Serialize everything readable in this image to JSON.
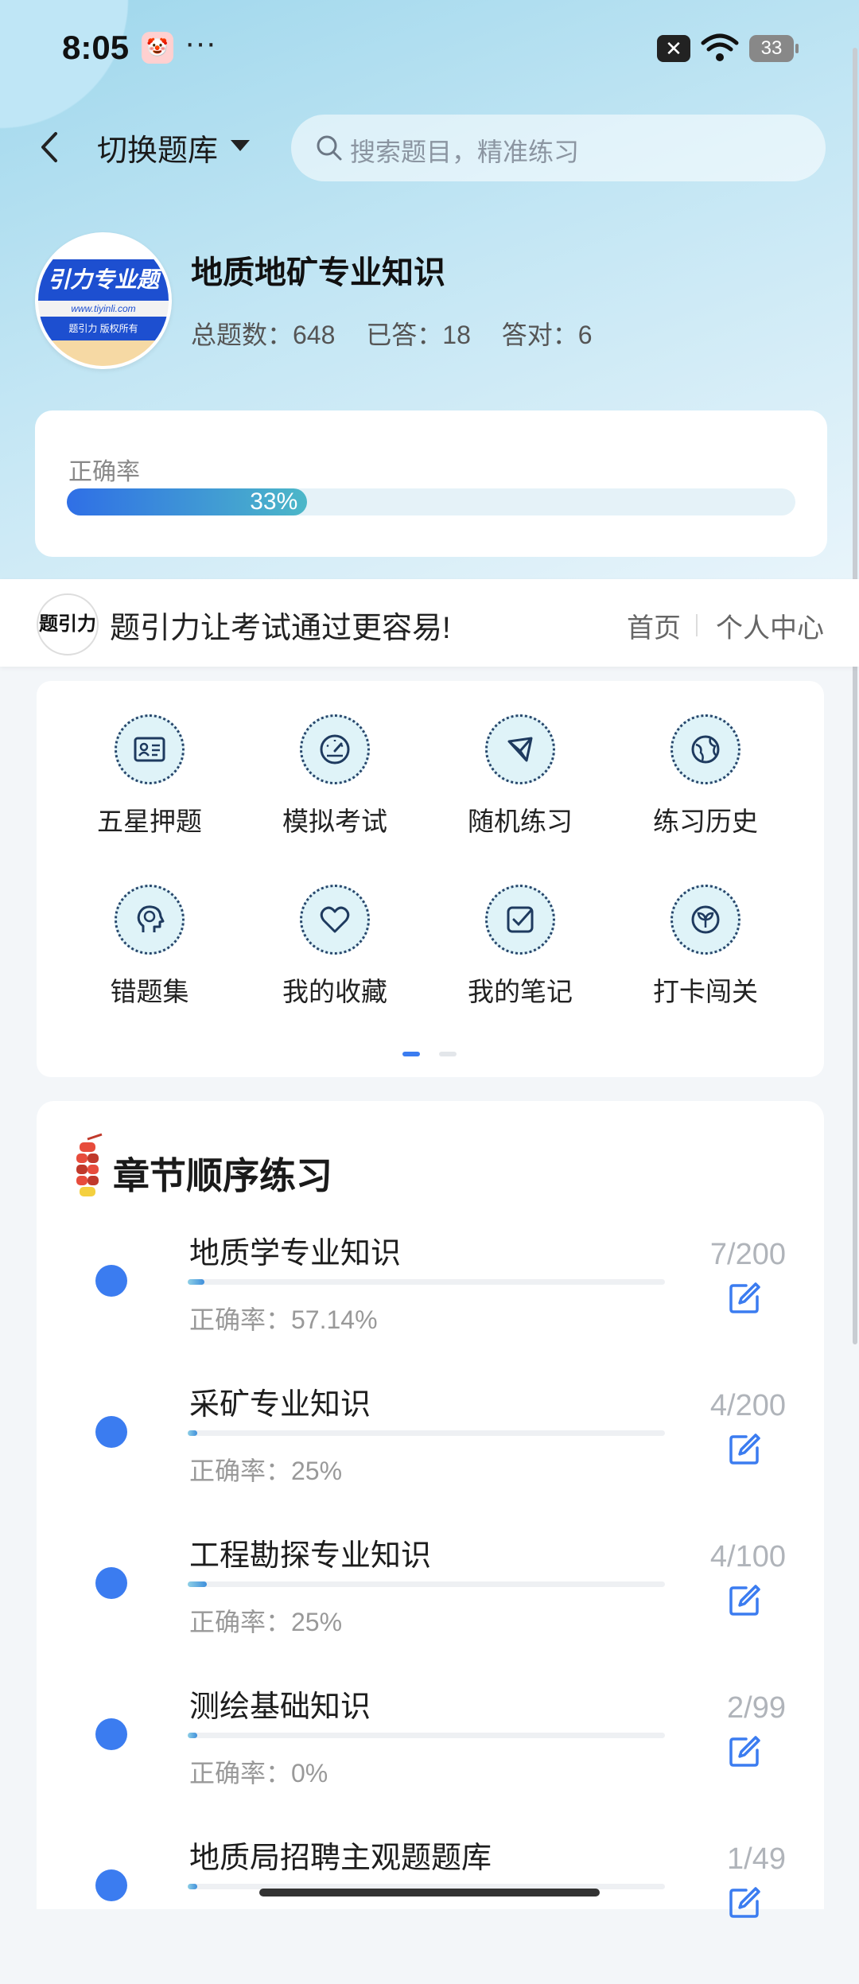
{
  "status_bar": {
    "time": "8:05",
    "more": "···",
    "battery": "33"
  },
  "header": {
    "switch_label": "切换题库",
    "search_placeholder": "搜索题目，精准练习"
  },
  "bank": {
    "logo_text": "引力专业题",
    "logo_url": "www.tiyinli.com",
    "logo_copyright": "题引力 版权所有",
    "title": "地质地矿专业知识",
    "total_label": "总题数：648",
    "answered_label": "已答：18",
    "correct_label": "答对：6"
  },
  "accuracy": {
    "label": "正确率",
    "value_text": "33%",
    "value": 0.33
  },
  "banner": {
    "logo_text": "题引力",
    "slogan": "题引力让考试通过更容易!",
    "home": "首页",
    "personal": "个人中心"
  },
  "menu": {
    "items": [
      {
        "label": "五星押题",
        "icon": "id-card-icon"
      },
      {
        "label": "模拟考试",
        "icon": "gauge-icon"
      },
      {
        "label": "随机练习",
        "icon": "network-icon"
      },
      {
        "label": "练习历史",
        "icon": "globe-icon"
      },
      {
        "label": "错题集",
        "icon": "head-icon"
      },
      {
        "label": "我的收藏",
        "icon": "heart-icon"
      },
      {
        "label": "我的笔记",
        "icon": "note-check-icon"
      },
      {
        "label": "打卡闯关",
        "icon": "leaf-badge-icon"
      }
    ],
    "page_index": 0,
    "page_count": 2
  },
  "chapters": {
    "title": "章节顺序练习",
    "items": [
      {
        "name": "地质学专业知识",
        "accuracy": "正确率：57.14%",
        "count": "7/200",
        "progress": 0.035
      },
      {
        "name": "采矿专业知识",
        "accuracy": "正确率：25%",
        "count": "4/200",
        "progress": 0.02
      },
      {
        "name": "工程勘探专业知识",
        "accuracy": "正确率：25%",
        "count": "4/100",
        "progress": 0.04
      },
      {
        "name": "测绘基础知识",
        "accuracy": "正确率：0%",
        "count": "2/99",
        "progress": 0.02
      },
      {
        "name": "地质局招聘主观题题库",
        "accuracy": "",
        "count": "1/49",
        "progress": 0.02
      }
    ]
  }
}
